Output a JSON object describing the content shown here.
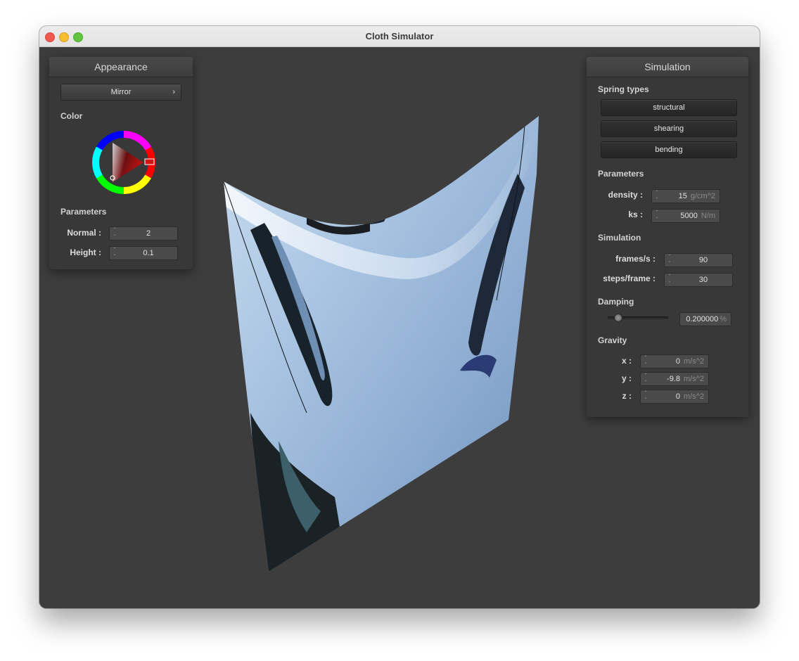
{
  "window": {
    "title": "Cloth Simulator"
  },
  "appearance": {
    "header": "Appearance",
    "shader": "Mirror",
    "color_label": "Color",
    "parameters_label": "Parameters",
    "normal": {
      "label": "Normal :",
      "value": "2"
    },
    "height": {
      "label": "Height :",
      "value": "0.1"
    },
    "selected_color": "#d01515"
  },
  "simulation": {
    "header": "Simulation",
    "spring_types_label": "Spring types",
    "spring_buttons": [
      "structural",
      "shearing",
      "bending"
    ],
    "parameters_label": "Parameters",
    "density": {
      "label": "density :",
      "value": "15",
      "unit": "g/cm^2"
    },
    "ks": {
      "label": "ks :",
      "value": "5000",
      "unit": "N/m"
    },
    "simulation_label": "Simulation",
    "frames_per_s": {
      "label": "frames/s :",
      "value": "90"
    },
    "steps_per_frame": {
      "label": "steps/frame :",
      "value": "30"
    },
    "damping_label": "Damping",
    "damping": {
      "value": "0.200000",
      "unit": "%",
      "slider_fraction": 0.2
    },
    "gravity_label": "Gravity",
    "gravity": {
      "x": {
        "label": "x :",
        "value": "0",
        "unit": "m/s^2"
      },
      "y": {
        "label": "y :",
        "value": "-9.8",
        "unit": "m/s^2"
      },
      "z": {
        "label": "z :",
        "value": "0",
        "unit": "m/s^2"
      }
    }
  }
}
